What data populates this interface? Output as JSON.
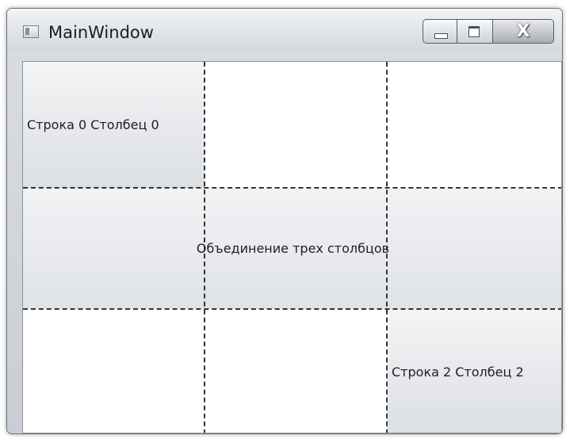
{
  "window": {
    "title": "MainWindow",
    "icons": {
      "app": "window-app-icon",
      "minimize": "minimize-icon",
      "maximize": "maximize-icon",
      "close": "close-icon"
    },
    "close_glyph": "X"
  },
  "grid": {
    "rows": 3,
    "columns": 3,
    "show_grid_lines": true,
    "cell_r0c0": "Строка 0 Столбец 0",
    "cell_row1_span": "Объединение трех столбцов",
    "cell_r2c2": "Строка 2 Столбец 2"
  }
}
